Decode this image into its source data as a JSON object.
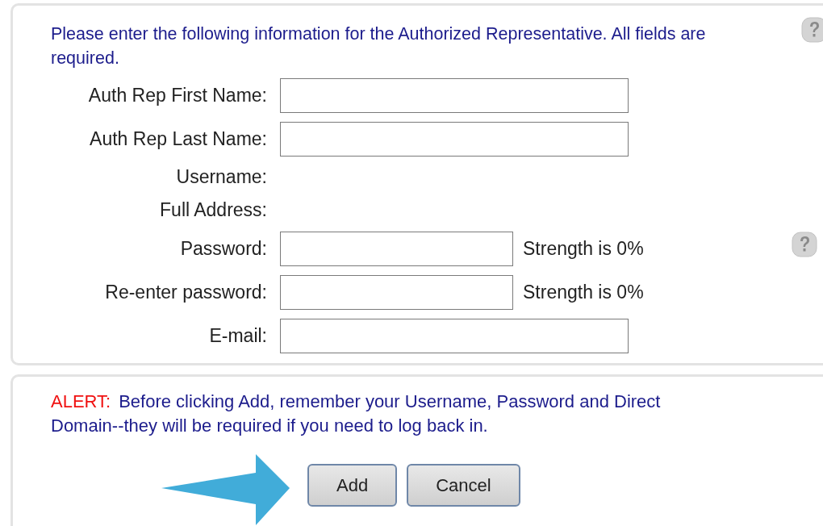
{
  "intro": "Please enter the following information for the Authorized Representative. All fields are required.",
  "fields": [
    {
      "kind": "input",
      "label": "Auth Rep First Name:"
    },
    {
      "kind": "input",
      "label": "Auth Rep Last Name:"
    },
    {
      "kind": "static",
      "label": "Username:"
    },
    {
      "kind": "static",
      "label": "Full Address:"
    },
    {
      "kind": "input",
      "label": "Password:",
      "strength": "Strength is 0%",
      "help": true
    },
    {
      "kind": "input",
      "label": "Re-enter password:",
      "strength": "Strength is 0%"
    },
    {
      "kind": "input",
      "label": "E-mail:"
    }
  ],
  "alert": {
    "label": "ALERT:",
    "message": "Before clicking Add, remember your Username, Password and Direct Domain--they will be required if you need to log back in."
  },
  "buttons": [
    "Add",
    "Cancel"
  ]
}
